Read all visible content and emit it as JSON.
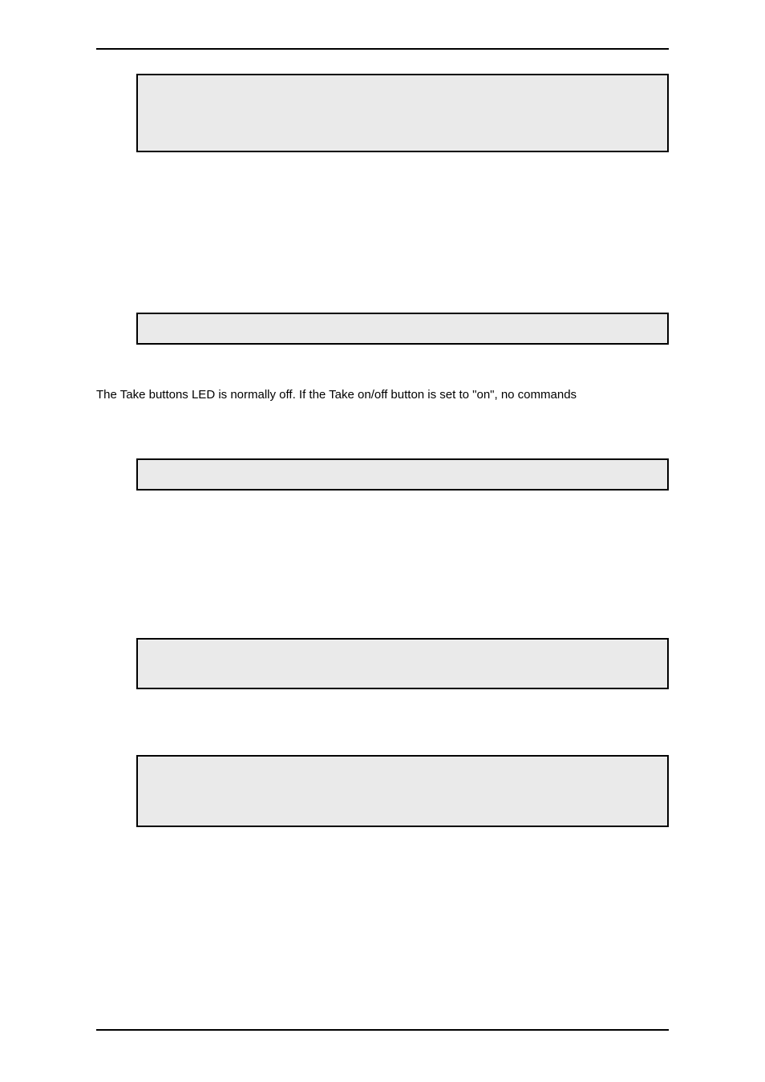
{
  "page_number": "",
  "body_paragraph_1": "The Take buttons LED is normally off. If the Take on/off button is set to \"on\", no commands",
  "boxes": {
    "b1": "",
    "b2": "",
    "b3": "",
    "b4": "",
    "b5": ""
  }
}
